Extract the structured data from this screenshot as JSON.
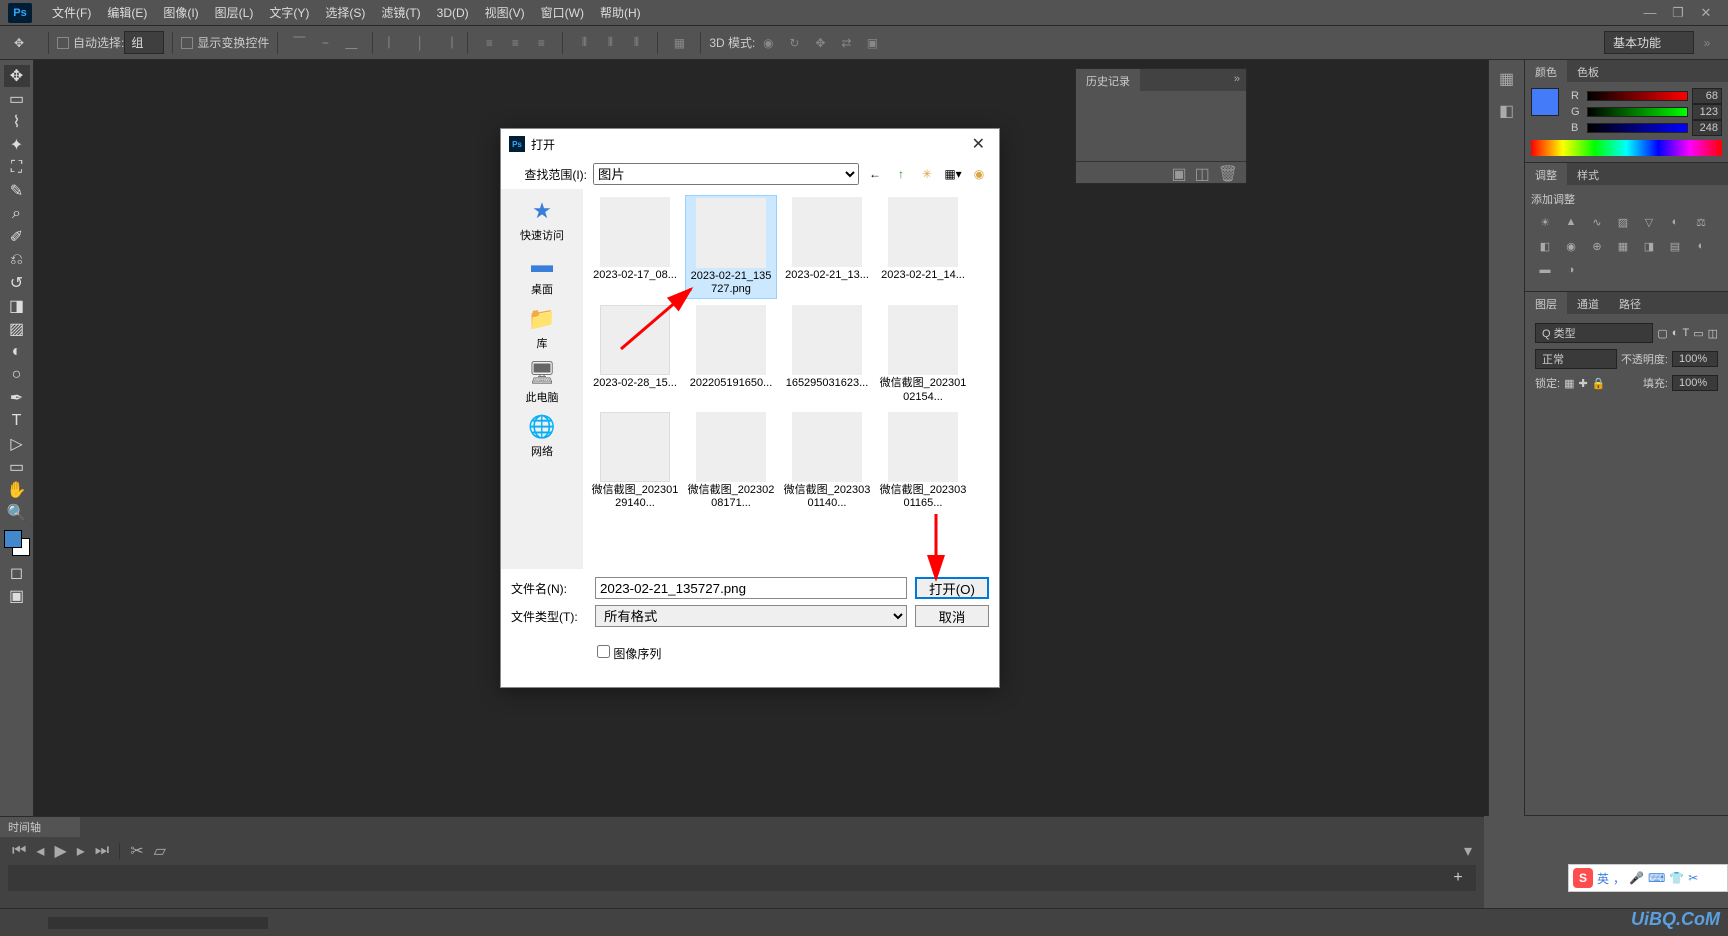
{
  "menubar": {
    "logo": "Ps",
    "items": [
      "文件(F)",
      "编辑(E)",
      "图像(I)",
      "图层(L)",
      "文字(Y)",
      "选择(S)",
      "滤镜(T)",
      "3D(D)",
      "视图(V)",
      "窗口(W)",
      "帮助(H)"
    ]
  },
  "optionsbar": {
    "auto_select": "自动选择:",
    "group": "组",
    "show_transform": "显示变换控件",
    "mode_3d": "3D 模式:",
    "right_select": "基本功能"
  },
  "panels": {
    "history": {
      "tab": "历史记录"
    },
    "color": {
      "tab_color": "颜色",
      "tab_swatches": "色板",
      "r": {
        "label": "R",
        "value": "68"
      },
      "g": {
        "label": "G",
        "value": "123"
      },
      "b": {
        "label": "B",
        "value": "248"
      }
    },
    "adjustments": {
      "tab_adjust": "调整",
      "tab_styles": "样式",
      "add_label": "添加调整"
    },
    "layers": {
      "tab_layers": "图层",
      "tab_channels": "通道",
      "tab_paths": "路径",
      "kind": "Q 类型",
      "blend": "正常",
      "opacity_label": "不透明度:",
      "opacity_value": "100%",
      "lock_label": "锁定:",
      "fill_label": "填充:",
      "fill_value": "100%"
    }
  },
  "timeline": {
    "tab": "时间轴"
  },
  "dialog": {
    "title": "打开",
    "lookin_label": "查找范围(I):",
    "lookin_value": "图片",
    "places": {
      "quick": "快速访问",
      "desktop": "桌面",
      "library": "库",
      "thispc": "此电脑",
      "network": "网络"
    },
    "files": [
      {
        "name": "2023-02-17_08...",
        "thumb_class": "thumb-white"
      },
      {
        "name": "2023-02-21_135727.png",
        "thumb_class": "thumb-person1",
        "selected": true
      },
      {
        "name": "2023-02-21_13...",
        "thumb_class": "thumb-person2"
      },
      {
        "name": "2023-02-21_14...",
        "thumb_class": "thumb-pink"
      },
      {
        "name": "2023-02-28_15...",
        "thumb_class": "thumb-doc"
      },
      {
        "name": "202205191650...",
        "thumb_class": "thumb-dark"
      },
      {
        "name": "165295031623...",
        "thumb_class": "thumb-dark"
      },
      {
        "name": "微信截图_20230102154...",
        "thumb_class": "thumb-bride"
      },
      {
        "name": "微信截图_20230129140...",
        "thumb_class": "thumb-doc"
      },
      {
        "name": "微信截图_20230208171...",
        "thumb_class": "thumb-house"
      },
      {
        "name": "微信截图_20230301140...",
        "thumb_class": "thumb-face"
      },
      {
        "name": "微信截图_20230301165...",
        "thumb_class": "thumb-blue"
      }
    ],
    "filename_label": "文件名(N):",
    "filename_value": "2023-02-21_135727.png",
    "filetype_label": "文件类型(T):",
    "filetype_value": "所有格式",
    "image_sequence": "图像序列",
    "open_btn": "打开(O)",
    "cancel_btn": "取消"
  },
  "ime": {
    "lang": "英"
  },
  "watermark": "UiBQ.CoM"
}
